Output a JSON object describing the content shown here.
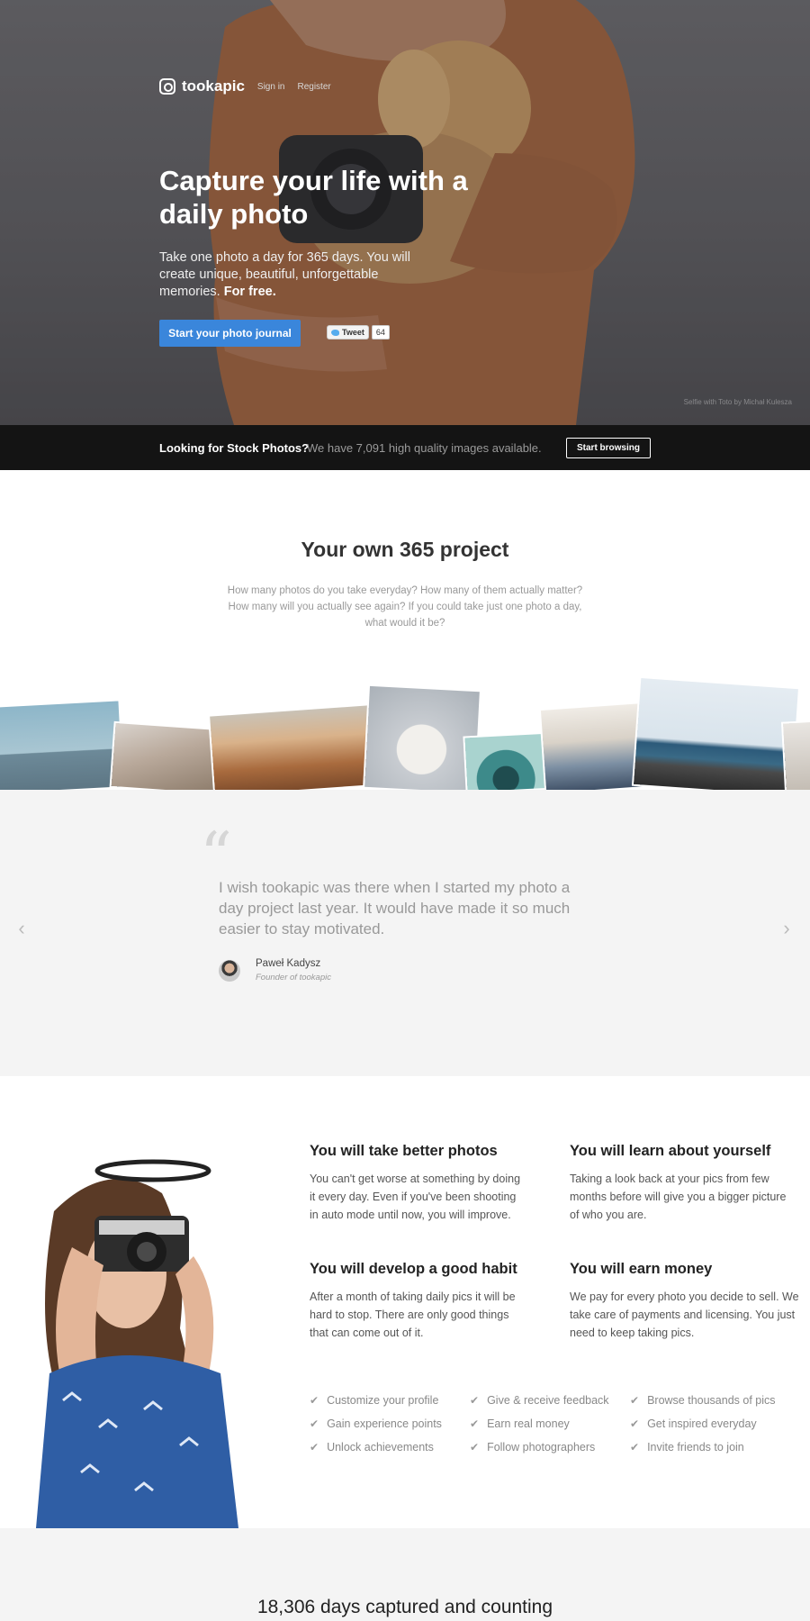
{
  "hero": {
    "logo": "tookapic",
    "nav": [
      "Sign in",
      "Register"
    ],
    "title": "Capture your life with a daily photo",
    "text": "Take one photo a day for 365 days. You will create unique, beautiful, unforgettable memories.",
    "text_bold": "For free.",
    "cta": "Start your photo journal",
    "tweet_label": "Tweet",
    "tweet_count": "64",
    "credit": "Selfie with Toto by Michał Kulesza"
  },
  "stock": {
    "question": "Looking for Stock Photos?",
    "message": "We have 7,091 high quality images available.",
    "button": "Start browsing"
  },
  "project": {
    "title": "Your own 365 project",
    "text": "How many photos do you take everyday? How many of them actually matter? How many will you actually see again? If you could take just one photo a day, what would it be?"
  },
  "testimonial": {
    "quote": "I wish tookapic was there when I started my photo a day project last year. It would have made it so much easier to stay motivated.",
    "author": "Paweł Kadysz",
    "role": "Founder of tookapic"
  },
  "benefits": [
    {
      "title": "You will take better photos",
      "text": "You can't get worse at something by doing it every day. Even if you've been shooting in auto mode until now, you will improve."
    },
    {
      "title": "You will learn about yourself",
      "text": "Taking a look back at your pics from few months before will give you a bigger picture of who you are."
    },
    {
      "title": "You will develop a good habit",
      "text": "After a month of taking daily pics it will be hard to stop. There are only good things that can come out of it."
    },
    {
      "title": "You will earn money",
      "text": "We pay for every photo you decide to sell. We take care of payments and licensing. You just need to keep taking pics."
    }
  ],
  "features": [
    "Customize your profile",
    "Give & receive feedback",
    "Browse thousands of pics",
    "Gain experience points",
    "Earn real money",
    "Get inspired everyday",
    "Unlock achievements",
    "Follow photographers",
    "Invite friends to join"
  ],
  "counter": "18,306 days captured and counting",
  "colors": {
    "accent": "#3a86db",
    "stock_bar": "#141414",
    "section_gray": "#f4f4f4"
  }
}
